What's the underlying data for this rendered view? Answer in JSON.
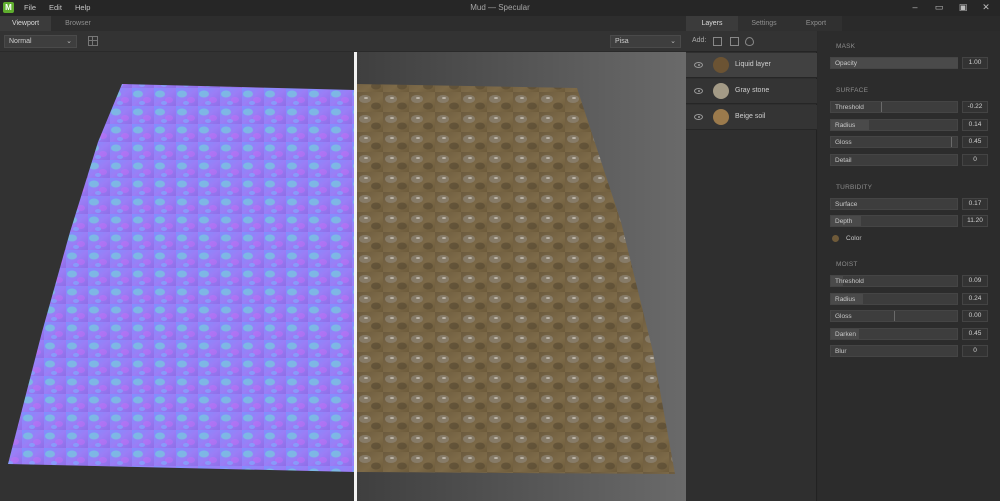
{
  "app": {
    "logo": "M",
    "title": "Mud — Specular"
  },
  "menu": [
    "File",
    "Edit",
    "Help"
  ],
  "window_controls": [
    "minimize-icon",
    "maximize-icon",
    "restore-icon",
    "close-icon"
  ],
  "left_tabs": [
    {
      "label": "Viewport",
      "active": true
    },
    {
      "label": "Browser",
      "active": false
    }
  ],
  "toolbar": {
    "mode": "Normal",
    "environment": "Pisa"
  },
  "viewport": {
    "left_view": "normal-map",
    "right_view": "specular",
    "colors": {
      "normal_a": "#8a7dff",
      "normal_b": "#b56cf0",
      "soil": "#7a6440",
      "background": "#3a3a3a"
    }
  },
  "right_tabs": [
    {
      "label": "Layers",
      "active": true
    },
    {
      "label": "Settings",
      "active": false
    },
    {
      "label": "Export",
      "active": false
    }
  ],
  "layers_panel": {
    "add_label": "Add:",
    "items": [
      {
        "label": "Liquid layer",
        "selected": true,
        "thumb": "#6b5333"
      },
      {
        "label": "Gray stone",
        "selected": false,
        "thumb": "#a39a86"
      },
      {
        "label": "Beige soil",
        "selected": false,
        "thumb": "#9b7a4c"
      }
    ]
  },
  "properties": {
    "mask": {
      "title": "MASK",
      "rows": [
        {
          "label": "Opacity",
          "value": "1.00"
        }
      ]
    },
    "surface": {
      "title": "SURFACE",
      "rows": [
        {
          "label": "Threshold",
          "value": "-0.22"
        },
        {
          "label": "Radius",
          "value": "0.14"
        },
        {
          "label": "Gloss",
          "value": "0.45"
        },
        {
          "label": "Detail",
          "value": "0"
        }
      ]
    },
    "turbidity": {
      "title": "TURBIDITY",
      "rows": [
        {
          "label": "Surface",
          "value": "0.17"
        },
        {
          "label": "Depth",
          "value": "11.20"
        }
      ],
      "color_label": "Color",
      "color": "#6f5a39"
    },
    "moist": {
      "title": "MOIST",
      "rows": [
        {
          "label": "Threshold",
          "value": "0.09"
        },
        {
          "label": "Radius",
          "value": "0.24"
        },
        {
          "label": "Gloss",
          "value": "0.00"
        },
        {
          "label": "Darken",
          "value": "0.45"
        },
        {
          "label": "Blur",
          "value": "0"
        }
      ]
    }
  }
}
